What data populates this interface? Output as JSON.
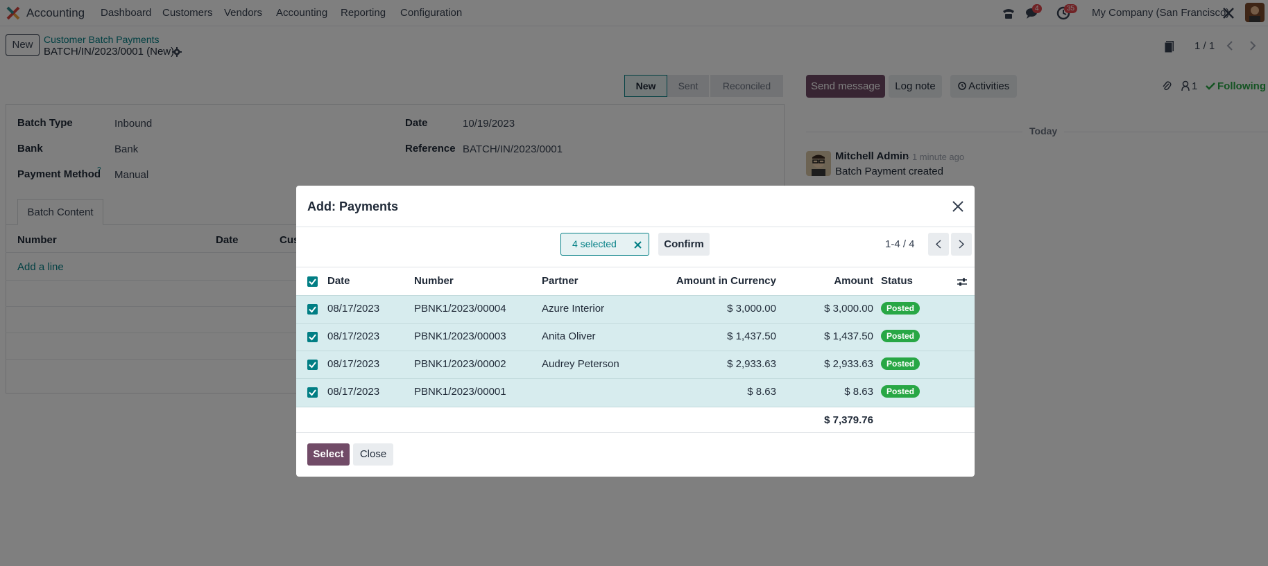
{
  "navbar": {
    "app_name": "Accounting",
    "menu": [
      "Dashboard",
      "Customers",
      "Vendors",
      "Accounting",
      "Reporting",
      "Configuration"
    ],
    "messages_badge": "4",
    "activities_badge": "35",
    "company": "My Company (San Francisco)"
  },
  "control_panel": {
    "new_label": "New",
    "breadcrumb": "Customer Batch Payments",
    "record_title": "BATCH/IN/2023/0001 (New)",
    "pager": "1 / 1"
  },
  "statusbar": {
    "steps": [
      "New",
      "Sent",
      "Reconciled"
    ],
    "active": "New"
  },
  "form": {
    "batch_type_label": "Batch Type",
    "batch_type_value": "Inbound",
    "bank_label": "Bank",
    "bank_value": "Bank",
    "payment_method_label": "Payment Method",
    "payment_method_help": "?",
    "payment_method_value": "Manual",
    "date_label": "Date",
    "date_value": "10/19/2023",
    "reference_label": "Reference",
    "reference_value": "BATCH/IN/2023/0001",
    "tab": "Batch Content",
    "columns": [
      "Number",
      "Date",
      "Cus"
    ],
    "add_line": "Add a line"
  },
  "chatter": {
    "send_message": "Send message",
    "log_note": "Log note",
    "activities": "Activities",
    "followers_count": "1",
    "following": "Following",
    "today": "Today",
    "author": "Mitchell Admin",
    "time": "- 1 minute ago",
    "message": "Batch Payment created"
  },
  "modal": {
    "title": "Add: Payments",
    "selected": "4 selected",
    "confirm": "Confirm",
    "pager": "1-4 / 4",
    "headers": [
      "Date",
      "Number",
      "Partner",
      "Amount in Currency",
      "Amount",
      "Status"
    ],
    "rows": [
      {
        "date": "08/17/2023",
        "number": "PBNK1/2023/00004",
        "partner": "Azure Interior",
        "amount_currency": "$ 3,000.00",
        "amount": "$ 3,000.00",
        "status": "Posted"
      },
      {
        "date": "08/17/2023",
        "number": "PBNK1/2023/00003",
        "partner": "Anita Oliver",
        "amount_currency": "$ 1,437.50",
        "amount": "$ 1,437.50",
        "status": "Posted"
      },
      {
        "date": "08/17/2023",
        "number": "PBNK1/2023/00002",
        "partner": "Audrey Peterson",
        "amount_currency": "$ 2,933.63",
        "amount": "$ 2,933.63",
        "status": "Posted"
      },
      {
        "date": "08/17/2023",
        "number": "PBNK1/2023/00001",
        "partner": "",
        "amount_currency": "$ 8.63",
        "amount": "$ 8.63",
        "status": "Posted"
      }
    ],
    "total": "$ 7,379.76",
    "select_button": "Select",
    "close_button": "Close"
  },
  "colors": {
    "brand": "#714b67",
    "accent": "#017e84",
    "posted": "#28a745",
    "selected_row": "#d7ecee"
  }
}
